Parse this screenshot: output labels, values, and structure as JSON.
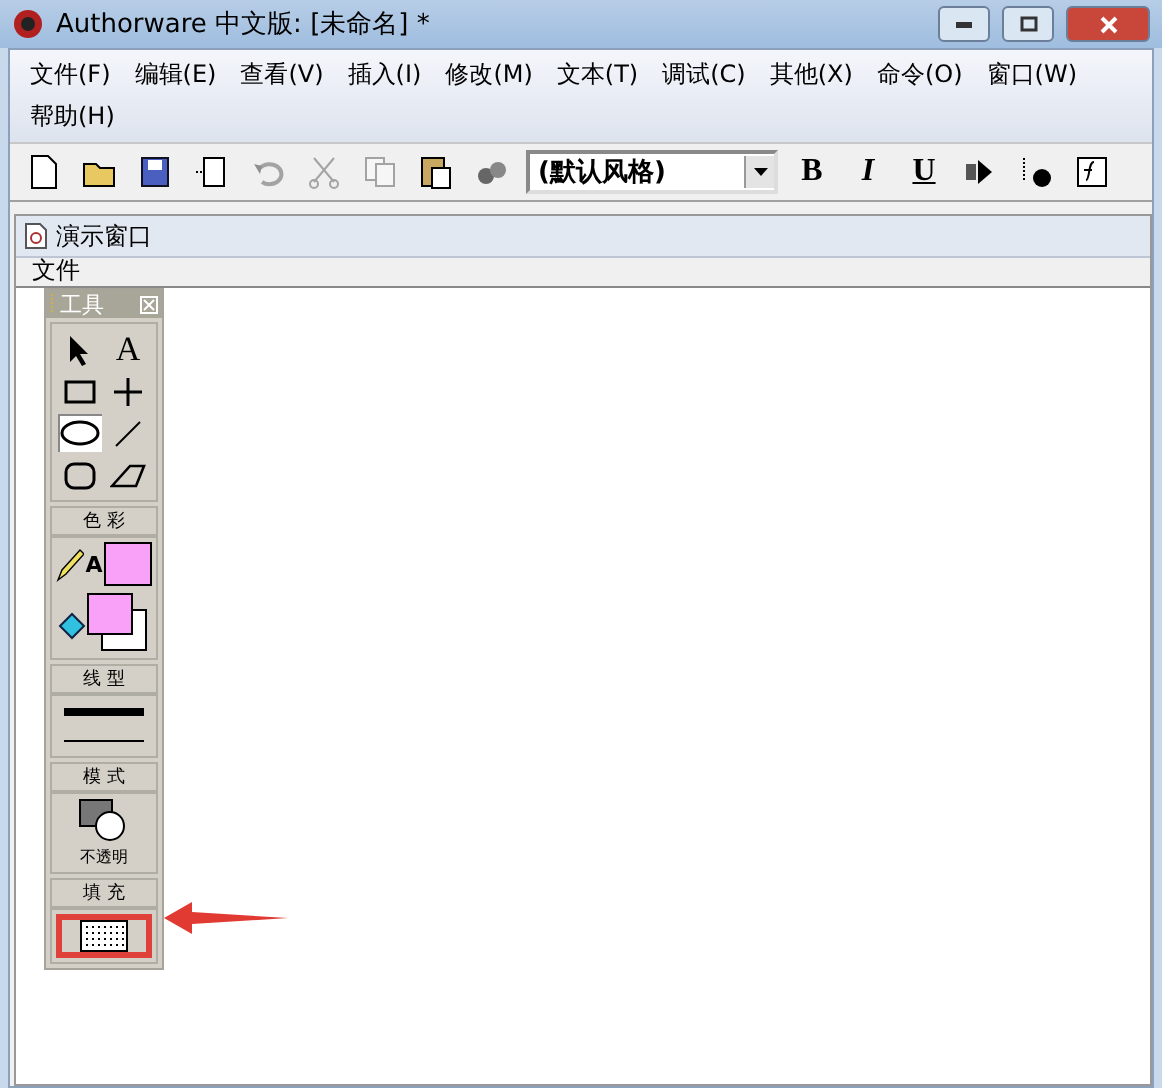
{
  "window": {
    "title": "Authorware 中文版: [未命名] *"
  },
  "menu": [
    "文件(F)",
    "编辑(E)",
    "查看(V)",
    "插入(I)",
    "修改(M)",
    "文本(T)",
    "调试(C)",
    "其他(X)",
    "命令(O)",
    "窗口(W)",
    "帮助(H)"
  ],
  "toolbar": {
    "buttons": [
      {
        "kind": "new",
        "disabled": false
      },
      {
        "kind": "open",
        "disabled": false
      },
      {
        "kind": "save",
        "disabled": false
      },
      {
        "kind": "import",
        "disabled": false
      },
      {
        "kind": "undo",
        "disabled": true
      },
      {
        "kind": "cut",
        "disabled": true
      },
      {
        "kind": "copy",
        "disabled": true
      },
      {
        "kind": "paste",
        "disabled": false
      },
      {
        "kind": "find",
        "disabled": false
      }
    ],
    "style_dropdown": {
      "value": "(默认风格)"
    },
    "format_buttons": [
      {
        "label": "B",
        "kind": "bold"
      },
      {
        "label": "I",
        "kind": "italic"
      },
      {
        "label": "U",
        "kind": "underline"
      }
    ]
  },
  "presentation_window": {
    "title": "演示窗口",
    "menu": [
      "文件"
    ]
  },
  "tool_palette": {
    "title": "工具",
    "tools": [
      {
        "kind": "pointer",
        "selected": false
      },
      {
        "kind": "text",
        "label": "A",
        "selected": false
      },
      {
        "kind": "rect",
        "selected": false
      },
      {
        "kind": "cross",
        "selected": false
      },
      {
        "kind": "ellipse",
        "selected": true
      },
      {
        "kind": "line",
        "selected": false
      },
      {
        "kind": "roundrect",
        "selected": false
      },
      {
        "kind": "polygon",
        "selected": false
      }
    ],
    "color_label": "色 彩",
    "text_color_label": "A",
    "line_label": "线 型",
    "mode_label": "模 式",
    "mode_value": "不透明",
    "fill_label": "填 充"
  }
}
